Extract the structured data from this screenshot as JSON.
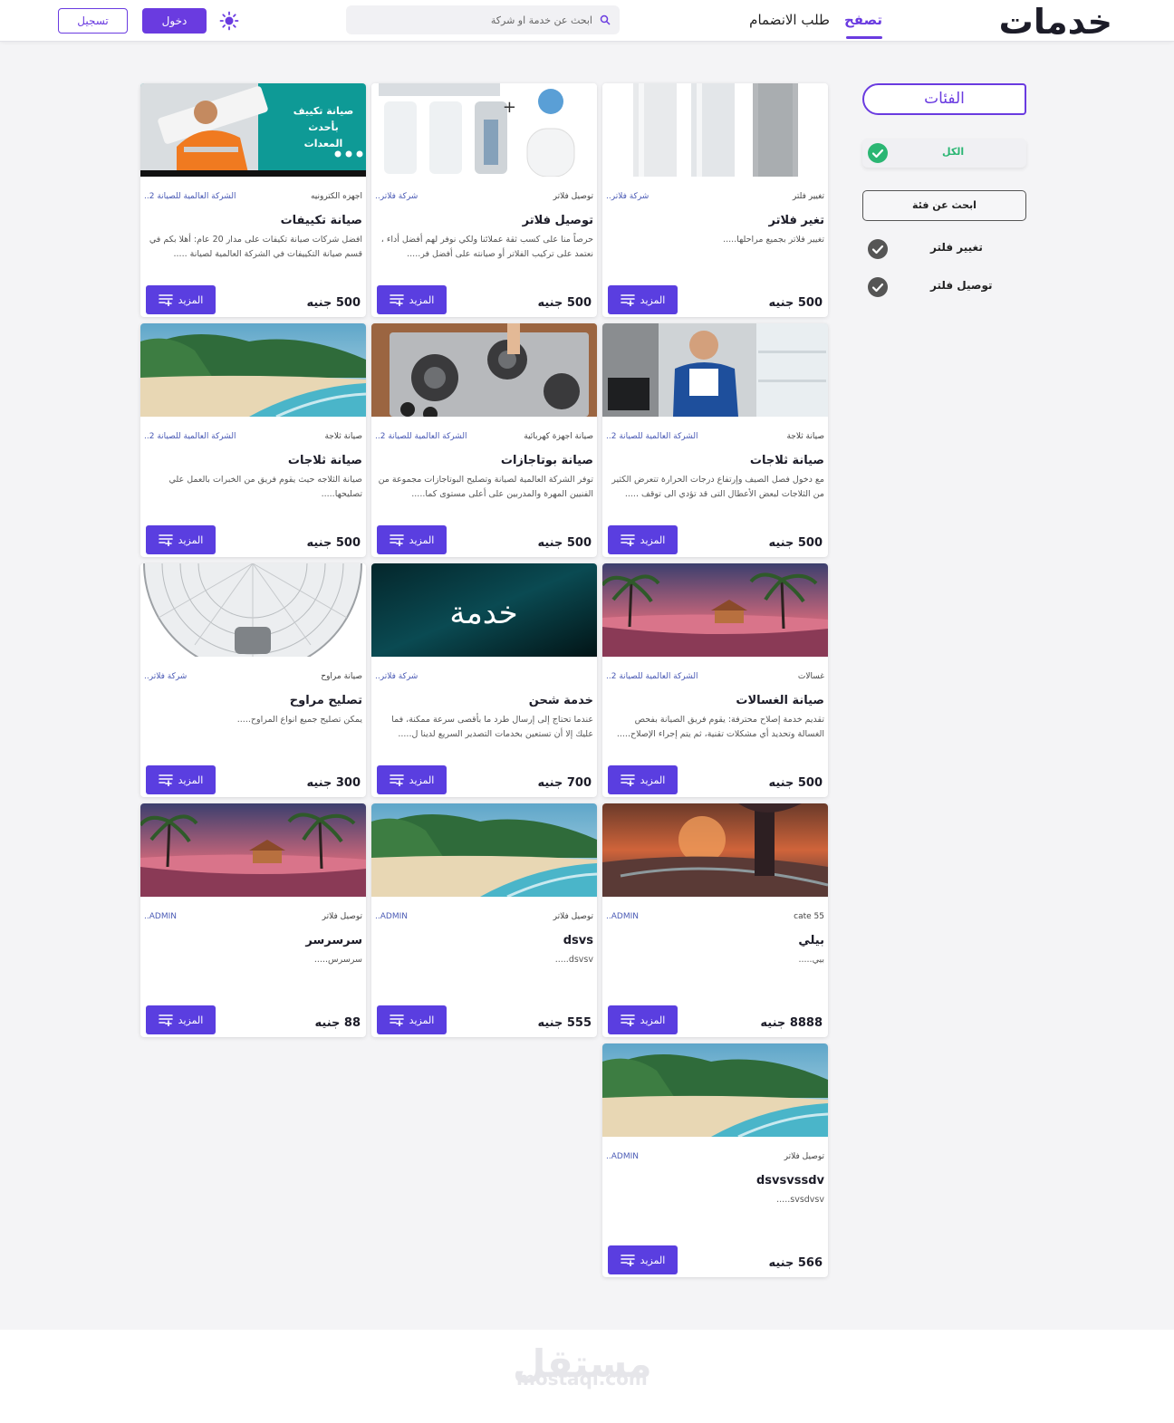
{
  "header": {
    "logo": "خدمات",
    "nav_browse": "تصفح",
    "nav_join": "طلب الانضمام",
    "search_placeholder": "ابحث عن خدمة او شركة",
    "login_label": "دخول",
    "register_label": "تسجيل",
    "theme_icon": "sun-icon",
    "accent_color": "#6a3be0"
  },
  "sidebar": {
    "title": "الفئات",
    "all_label": "الكل",
    "search_category_label": "ابحث عن فئة",
    "categories": [
      {
        "label": "تغيير فلتر"
      },
      {
        "label": "توصيل فلتر"
      }
    ]
  },
  "cards": [
    {
      "category": "تغيير فلتر",
      "company": "شركة فلاتر..",
      "title": "تغير فلاتر",
      "desc": "تغيير فلاتر بجميع مراحلها.....",
      "price": "500 جنيه",
      "more": "المزيد"
    },
    {
      "category": "توصيل فلاتر",
      "company": "شركة فلاتر..",
      "title": "توصيل فلاتر",
      "desc": "حرصاً منا على كسب ثقة عملائنا ولكي نوفر لهم أفضل أداء ، نعتمد على تركيب الفلاتر أو صيانته على أفضل فر.....",
      "price": "500 جنيه",
      "more": "المزيد"
    },
    {
      "category": "اجهزه الكترونيه",
      "company": "الشركة العالمية للصيانة 2..",
      "title": "صيانة تكييفات",
      "desc": "افضل شركات صيانة تكيفات على مدار 20 عام: أهلا بكم في قسم صيانة التكييفات في الشركة العالمية لصيانة .....",
      "price": "500 جنيه",
      "more": "المزيد"
    },
    {
      "category": "صيانة ثلاجة",
      "company": "الشركة العالمية للصيانة 2..",
      "title": "صيانة ثلاجات",
      "desc": "مع دخول فصل الصيف وإرتفاع درجات الحرارة تتعرض الكثير من الثلاجات لبعض الأعطال التى قد تؤدي الى توقف .....",
      "price": "500 جنيه",
      "more": "المزيد"
    },
    {
      "category": "صيانة اجهزة كهربائية",
      "company": "الشركة العالمية للصيانة 2..",
      "title": "صيانة بوتاجازات",
      "desc": "توفر الشركة العالمية لصيانة وتصليح البوتاجازات مجموعة من الفنيين المهرة والمدربين على أعلى مستوى كما.....",
      "price": "500 جنيه",
      "more": "المزيد"
    },
    {
      "category": "صيانة ثلاجة",
      "company": "الشركة العالمية للصيانة 2..",
      "title": "صيانة ثلاجات",
      "desc": "صيانة الثلاجه حيث يقوم فريق من الخبرات بالعمل علي تصليحها.....",
      "price": "500 جنيه",
      "more": "المزيد"
    },
    {
      "category": "غسالات",
      "company": "الشركة العالمية للصيانة 2..",
      "title": "صيانة الغسالات",
      "desc": "تقديم خدمة إصلاح محترفة: يقوم فريق الصيانة بفحص الغسالة وتحديد أي مشكلات تقنية، ثم يتم إجراء الإصلاح.....",
      "price": "500 جنيه",
      "more": "المزيد"
    },
    {
      "category": "",
      "company": "شركة فلاتر..",
      "title": "خدمة شحن",
      "desc": "عندما تحتاج إلى إرسال طرد ما بأقصى سرعة ممكنة، فما عليك إلا أن تستعين بخدمات التصدير السريع لدينا ل.....",
      "price": "700 جنيه",
      "more": "المزيد",
      "image_text": "خدمة"
    },
    {
      "category": "صيانة مراوح",
      "company": "شركة فلاتر..",
      "title": "تصليح مراوح",
      "desc": "يمكن تصليح جميع انواع المراوح.....",
      "price": "300 جنيه",
      "more": "المزيد"
    },
    {
      "category": "cate 55",
      "company": "ADMIN..",
      "title": "بيلي",
      "desc": "بيي.....",
      "price": "8888 جنيه",
      "more": "المزيد"
    },
    {
      "category": "توصيل فلاتر",
      "company": "ADMIN..",
      "title": "dsvs",
      "desc": "dsvsv.....",
      "price": "555 جنيه",
      "more": "المزيد"
    },
    {
      "category": "توصيل فلاتر",
      "company": "ADMIN..",
      "title": "سرسرسر",
      "desc": "سرسرس.....",
      "price": "88 جنيه",
      "more": "المزيد"
    },
    {
      "category": "توصيل فلاتر",
      "company": "ADMIN..",
      "title": "dsvsvssdv",
      "desc": "svsdvsv.....",
      "price": "566 جنيه",
      "more": "المزيد"
    }
  ],
  "footer": {
    "watermark_ar": "مستقل",
    "watermark_en": "mostaql.com"
  }
}
